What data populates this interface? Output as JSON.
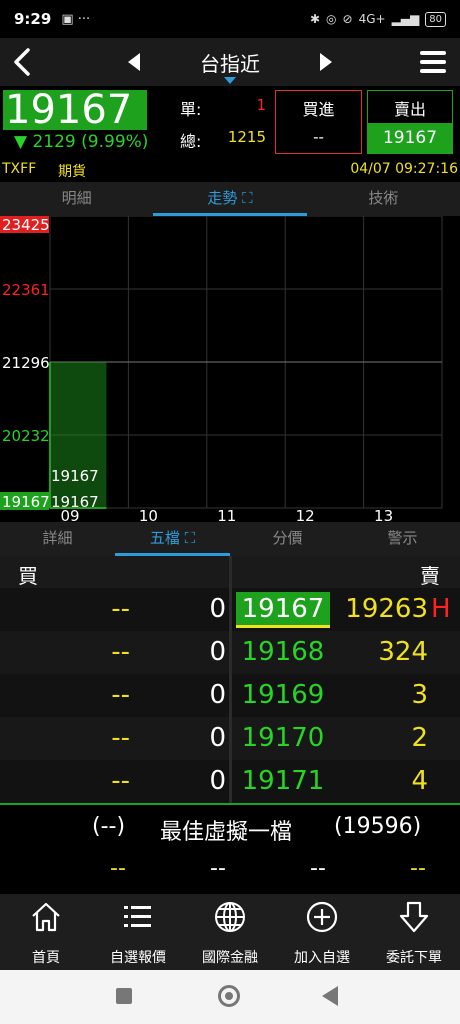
{
  "status_bar": {
    "time": "9:29",
    "battery": "80",
    "network": "4G+"
  },
  "header": {
    "title": "台指近"
  },
  "quote": {
    "price": "19167",
    "change": "▼ 2129 (9.99%)",
    "single_label": "單:",
    "single_value": "1",
    "total_label": "總:",
    "total_value": "1215",
    "buy_label": "買進",
    "buy_value": "--",
    "sell_label": "賣出",
    "sell_value": "19167"
  },
  "info": {
    "code": "TXFF",
    "type": "期貨",
    "datetime": "04/07 09:27:16"
  },
  "tabs_top": [
    {
      "label": "明細",
      "active": false
    },
    {
      "label": "走勢",
      "active": true
    },
    {
      "label": "技術",
      "active": false
    }
  ],
  "chart_data": {
    "type": "area",
    "y_ticks": [
      {
        "value": 23425,
        "color": "#e02020",
        "bg": true
      },
      {
        "value": 22361,
        "color": "#ff2020",
        "bg": false
      },
      {
        "value": 21296,
        "color": "#ffffff",
        "bg": false
      },
      {
        "value": 20232,
        "color": "#27d427",
        "bg": false
      },
      {
        "value": 19167,
        "color": "#ffffff",
        "bg": true
      }
    ],
    "x_ticks": [
      "09",
      "10",
      "11",
      "12",
      "13"
    ],
    "ylim": [
      19167,
      23425
    ],
    "reference": 21296,
    "series_last": "19167",
    "series_low": "19167",
    "color": "#1ea21e"
  },
  "tabs_bottom": [
    {
      "label": "詳細",
      "active": false
    },
    {
      "label": "五檔",
      "active": true
    },
    {
      "label": "分價",
      "active": false
    },
    {
      "label": "警示",
      "active": false
    }
  ],
  "order_book": {
    "buy_header": "買",
    "sell_header": "賣",
    "rows": [
      {
        "bid_volume": "--",
        "bid_price": "0",
        "ask_price": "19167",
        "ask_volume": "19263",
        "flag": "H"
      },
      {
        "bid_volume": "--",
        "bid_price": "0",
        "ask_price": "19168",
        "ask_volume": "324",
        "flag": ""
      },
      {
        "bid_volume": "--",
        "bid_price": "0",
        "ask_price": "19169",
        "ask_volume": "3",
        "flag": ""
      },
      {
        "bid_volume": "--",
        "bid_price": "0",
        "ask_price": "19170",
        "ask_volume": "2",
        "flag": ""
      },
      {
        "bid_volume": "--",
        "bid_price": "0",
        "ask_price": "19171",
        "ask_volume": "4",
        "flag": ""
      }
    ],
    "best_left": "(--)",
    "best_label": "最佳虛擬一檔",
    "best_right": "(19596)",
    "dashes": [
      "--",
      "--",
      "--",
      "--"
    ]
  },
  "bottom_nav": [
    {
      "label": "首頁",
      "icon": "home-icon"
    },
    {
      "label": "自選報價",
      "icon": "list-icon"
    },
    {
      "label": "國際金融",
      "icon": "globe-icon"
    },
    {
      "label": "加入自選",
      "icon": "add-icon"
    },
    {
      "label": "委託下單",
      "icon": "order-icon"
    }
  ]
}
